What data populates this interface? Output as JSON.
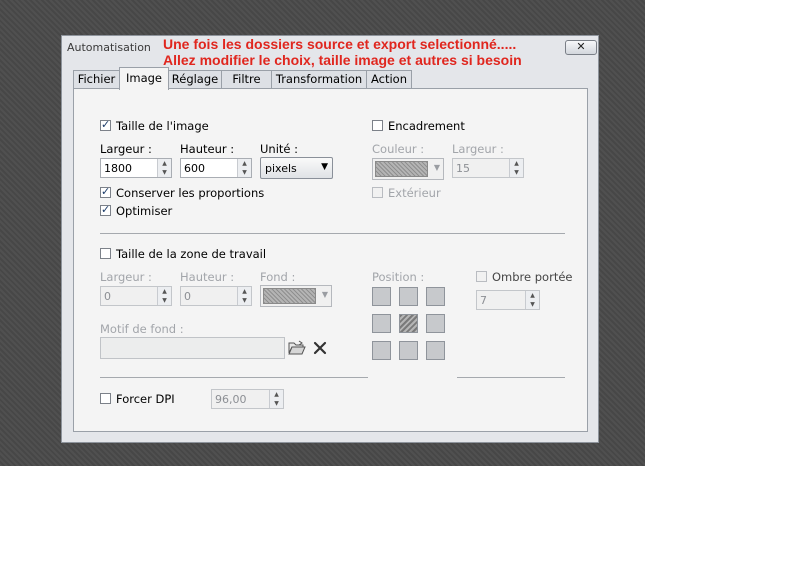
{
  "window": {
    "title": "Automatisation",
    "close_symbol": "✕"
  },
  "annotation": {
    "line1": "Une fois les dossiers source et export selectionné.....",
    "line2": "Allez modifier le choix, taille image et autres si besoin",
    "color": "#e0261e"
  },
  "tabs": [
    "Fichier",
    "Image",
    "Réglage",
    "Filtre",
    "Transformation",
    "Action"
  ],
  "active_tab": "Image",
  "image_size": {
    "checkbox_label": "Taille de l'image",
    "checked": true,
    "width_label": "Largeur :",
    "width_value": "1800",
    "height_label": "Hauteur :",
    "height_value": "600",
    "unit_label": "Unité :",
    "unit_value": "pixels",
    "keep_ratio_label": "Conserver les proportions",
    "keep_ratio_checked": true,
    "optimize_label": "Optimiser",
    "optimize_checked": true
  },
  "frame": {
    "checkbox_label": "Encadrement",
    "checked": false,
    "color_label": "Couleur :",
    "width_label": "Largeur :",
    "width_value": "15",
    "outside_label": "Extérieur",
    "outside_checked": false
  },
  "canvas": {
    "checkbox_label": "Taille de la zone de travail",
    "checked": false,
    "width_label": "Largeur :",
    "width_value": "0",
    "height_label": "Hauteur :",
    "height_value": "0",
    "background_label": "Fond :",
    "position_label": "Position :",
    "shadow_label": "Ombre portée",
    "shadow_checked": false,
    "shadow_value": "7",
    "pattern_label": "Motif de fond :",
    "pattern_value": ""
  },
  "dpi": {
    "checkbox_label": "Forcer DPI",
    "checked": false,
    "value": "96,00"
  }
}
